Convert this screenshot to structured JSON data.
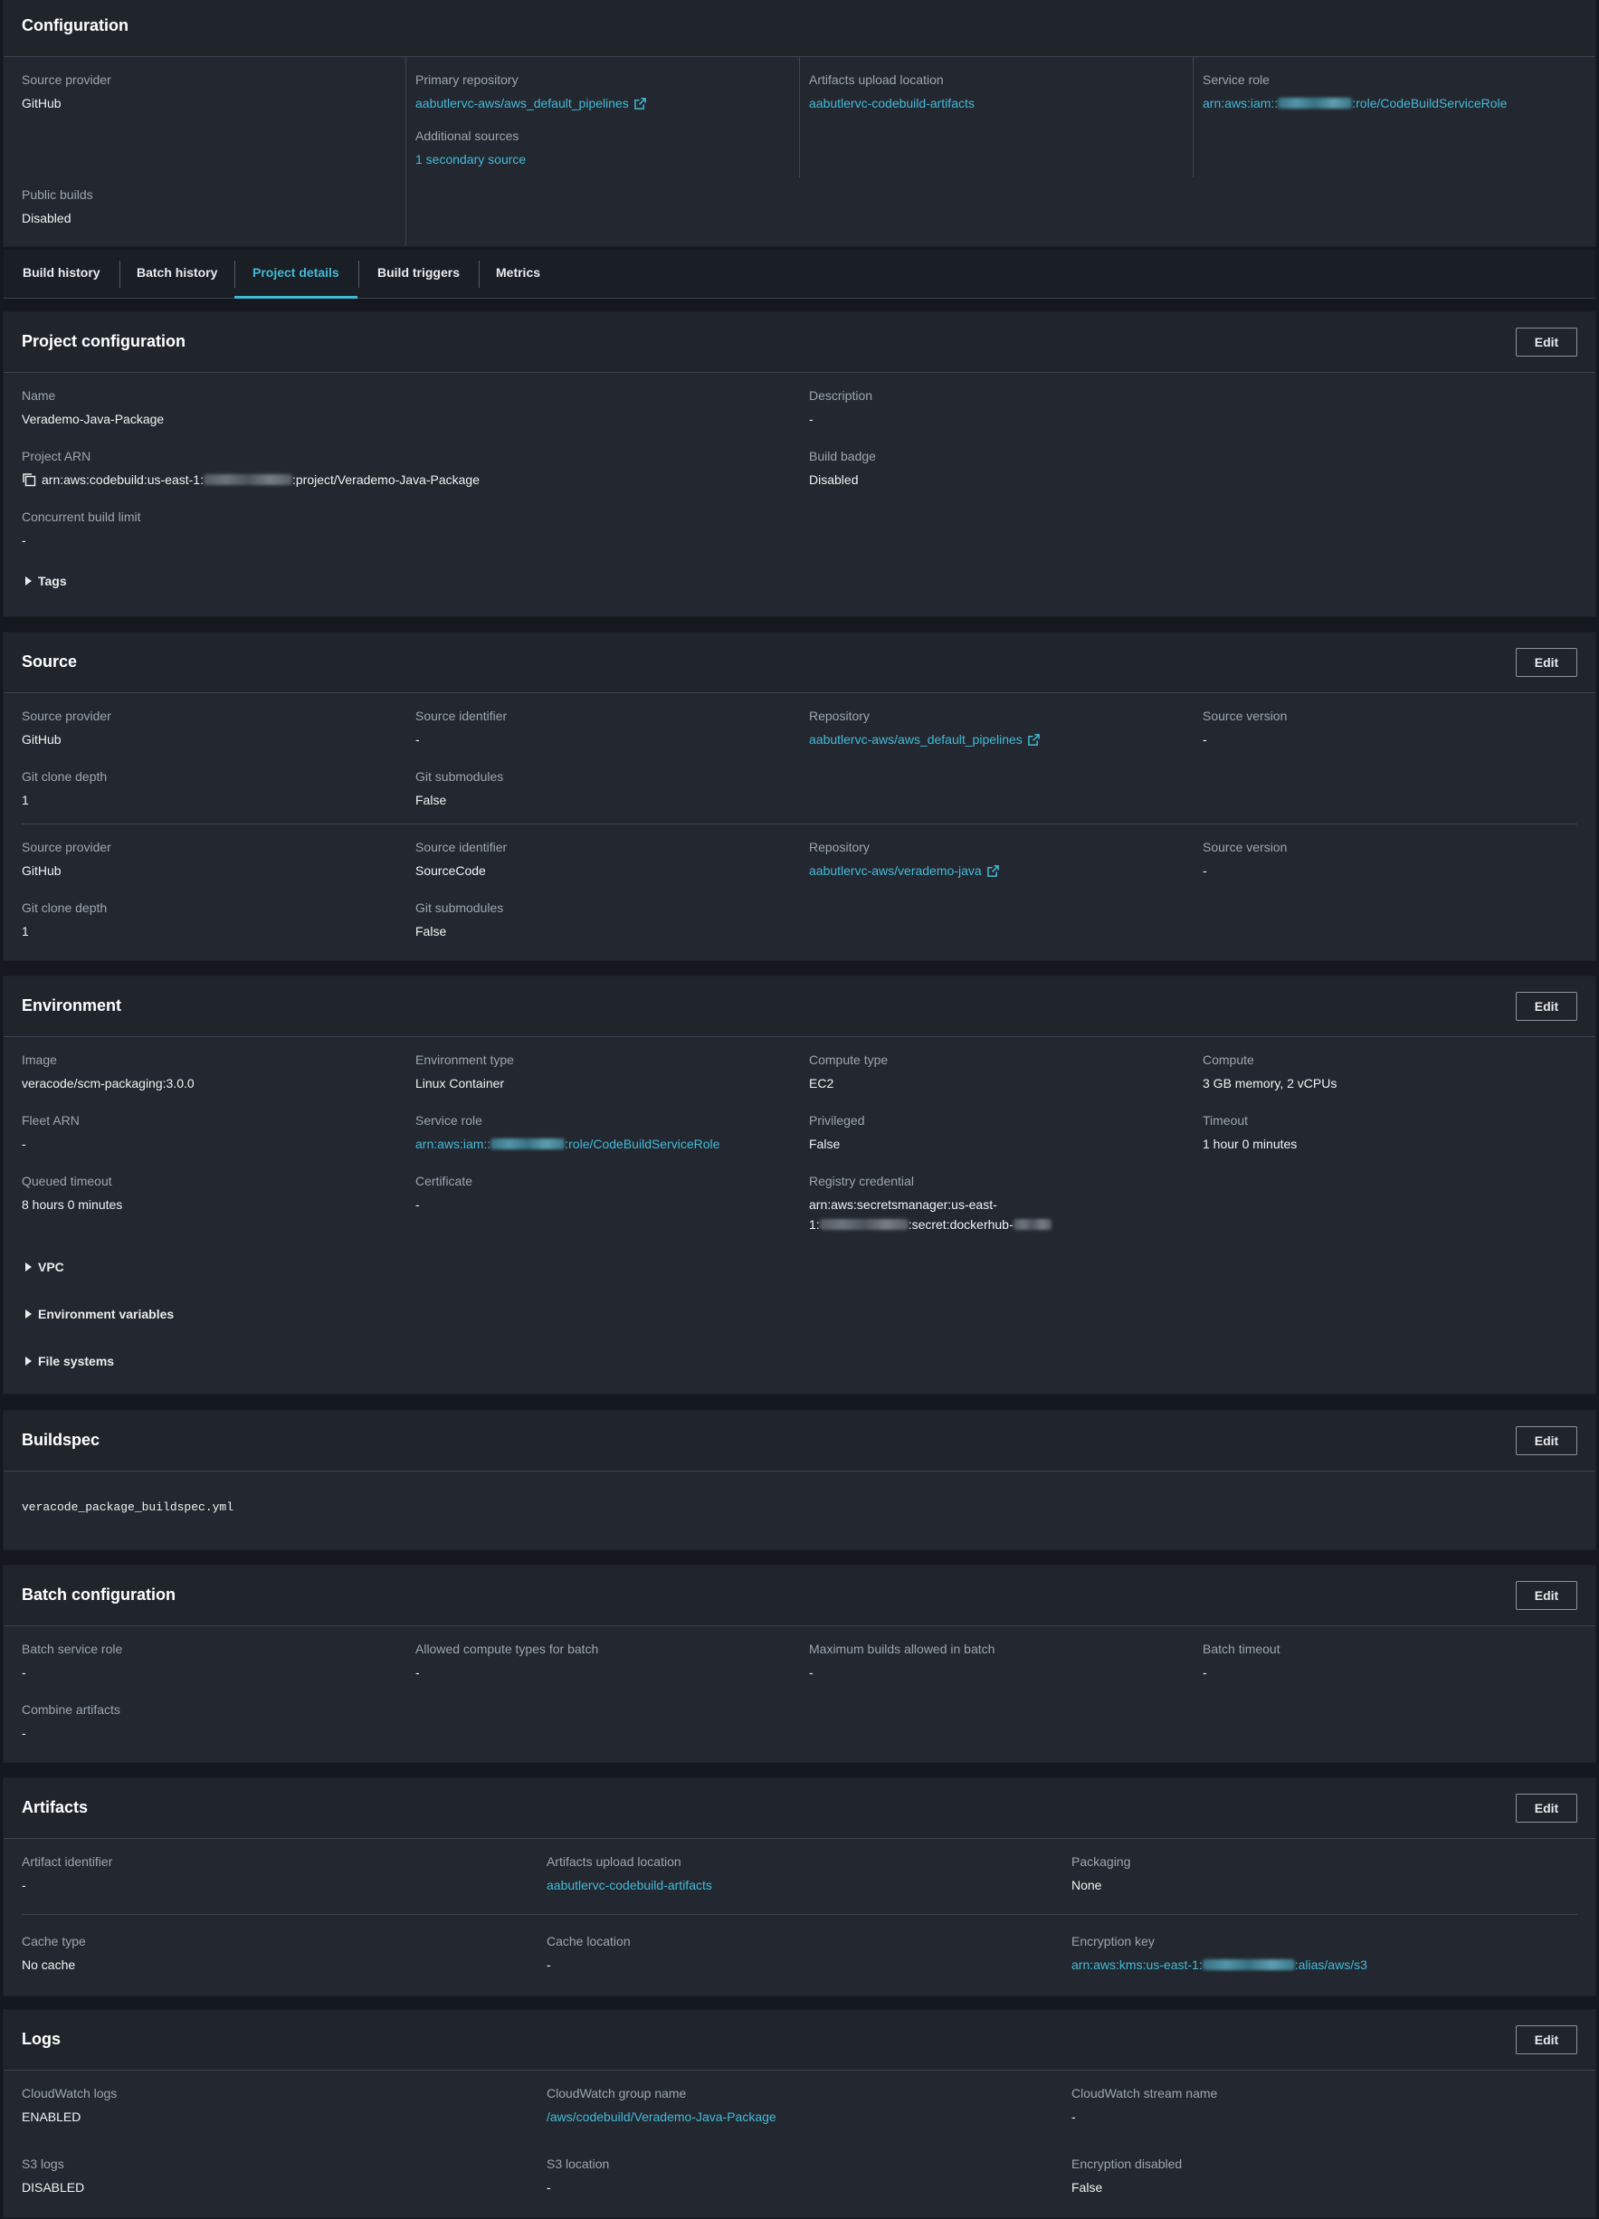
{
  "configuration": {
    "title": "Configuration",
    "source_provider": {
      "label": "Source provider",
      "value": "GitHub"
    },
    "primary_repository": {
      "label": "Primary repository",
      "value": "aabutlervc-aws/aws_default_pipelines"
    },
    "additional_sources": {
      "label": "Additional sources",
      "value": "1 secondary source"
    },
    "artifacts_upload_location": {
      "label": "Artifacts upload location",
      "value": "aabutlervc-codebuild-artifacts"
    },
    "service_role": {
      "label": "Service role",
      "prefix": "arn:aws:iam::",
      "suffix": ":role/CodeBuildServiceRole"
    },
    "public_builds": {
      "label": "Public builds",
      "value": "Disabled"
    }
  },
  "tabs": [
    "Build history",
    "Batch history",
    "Project details",
    "Build triggers",
    "Metrics"
  ],
  "active_tab": "Project details",
  "edit_label": "Edit",
  "project_configuration": {
    "title": "Project configuration",
    "name": {
      "label": "Name",
      "value": "Verademo-Java-Package"
    },
    "description": {
      "label": "Description",
      "value": "-"
    },
    "project_arn": {
      "label": "Project ARN",
      "prefix": "arn:aws:codebuild:us-east-1:",
      "suffix": ":project/Verademo-Java-Package"
    },
    "build_badge": {
      "label": "Build badge",
      "value": "Disabled"
    },
    "concurrent_build_limit": {
      "label": "Concurrent build limit",
      "value": "-"
    },
    "tags_label": "Tags"
  },
  "source": {
    "title": "Source",
    "primary": {
      "source_provider": {
        "label": "Source provider",
        "value": "GitHub"
      },
      "source_identifier": {
        "label": "Source identifier",
        "value": "-"
      },
      "repository": {
        "label": "Repository",
        "value": "aabutlervc-aws/aws_default_pipelines"
      },
      "source_version": {
        "label": "Source version",
        "value": "-"
      },
      "git_clone_depth": {
        "label": "Git clone depth",
        "value": "1"
      },
      "git_submodules": {
        "label": "Git submodules",
        "value": "False"
      }
    },
    "secondary": {
      "source_provider": {
        "label": "Source provider",
        "value": "GitHub"
      },
      "source_identifier": {
        "label": "Source identifier",
        "value": "SourceCode"
      },
      "repository": {
        "label": "Repository",
        "value": "aabutlervc-aws/verademo-java"
      },
      "source_version": {
        "label": "Source version",
        "value": "-"
      },
      "git_clone_depth": {
        "label": "Git clone depth",
        "value": "1"
      },
      "git_submodules": {
        "label": "Git submodules",
        "value": "False"
      }
    }
  },
  "environment": {
    "title": "Environment",
    "image": {
      "label": "Image",
      "value": "veracode/scm-packaging:3.0.0"
    },
    "environment_type": {
      "label": "Environment type",
      "value": "Linux Container"
    },
    "compute_type": {
      "label": "Compute type",
      "value": "EC2"
    },
    "compute": {
      "label": "Compute",
      "value": "3 GB memory, 2 vCPUs"
    },
    "fleet_arn": {
      "label": "Fleet ARN",
      "value": "-"
    },
    "service_role": {
      "label": "Service role",
      "prefix": "arn:aws:iam::",
      "suffix": ":role/CodeBuildServiceRole"
    },
    "privileged": {
      "label": "Privileged",
      "value": "False"
    },
    "timeout": {
      "label": "Timeout",
      "value": "1 hour 0 minutes"
    },
    "queued_timeout": {
      "label": "Queued timeout",
      "value": "8 hours 0 minutes"
    },
    "certificate": {
      "label": "Certificate",
      "value": "-"
    },
    "registry_credential": {
      "label": "Registry credential",
      "line1": "arn:aws:secretsmanager:us-east-",
      "line2_prefix": "1:",
      "line2_mid": ":secret:dockerhub-"
    },
    "vpc_label": "VPC",
    "env_vars_label": "Environment variables",
    "file_systems_label": "File systems"
  },
  "buildspec": {
    "title": "Buildspec",
    "file": "veracode_package_buildspec.yml"
  },
  "batch_configuration": {
    "title": "Batch configuration",
    "batch_service_role": {
      "label": "Batch service role",
      "value": "-"
    },
    "allowed_compute_types": {
      "label": "Allowed compute types for batch",
      "value": "-"
    },
    "max_builds": {
      "label": "Maximum builds allowed in batch",
      "value": "-"
    },
    "batch_timeout": {
      "label": "Batch timeout",
      "value": "-"
    },
    "combine_artifacts": {
      "label": "Combine artifacts",
      "value": "-"
    }
  },
  "artifacts": {
    "title": "Artifacts",
    "artifact_identifier": {
      "label": "Artifact identifier",
      "value": "-"
    },
    "upload_location": {
      "label": "Artifacts upload location",
      "value": "aabutlervc-codebuild-artifacts"
    },
    "packaging": {
      "label": "Packaging",
      "value": "None"
    },
    "cache_type": {
      "label": "Cache type",
      "value": "No cache"
    },
    "cache_location": {
      "label": "Cache location",
      "value": "-"
    },
    "encryption_key": {
      "label": "Encryption key",
      "prefix": "arn:aws:kms:us-east-1:",
      "suffix": ":alias/aws/s3"
    }
  },
  "logs": {
    "title": "Logs",
    "cloudwatch_logs": {
      "label": "CloudWatch logs",
      "value": "ENABLED"
    },
    "cloudwatch_group": {
      "label": "CloudWatch group name",
      "value": "/aws/codebuild/Verademo-Java-Package"
    },
    "cloudwatch_stream": {
      "label": "CloudWatch stream name",
      "value": "-"
    },
    "s3_logs": {
      "label": "S3 logs",
      "value": "DISABLED"
    },
    "s3_location": {
      "label": "S3 location",
      "value": "-"
    },
    "encryption_disabled": {
      "label": "Encryption disabled",
      "value": "False"
    }
  }
}
